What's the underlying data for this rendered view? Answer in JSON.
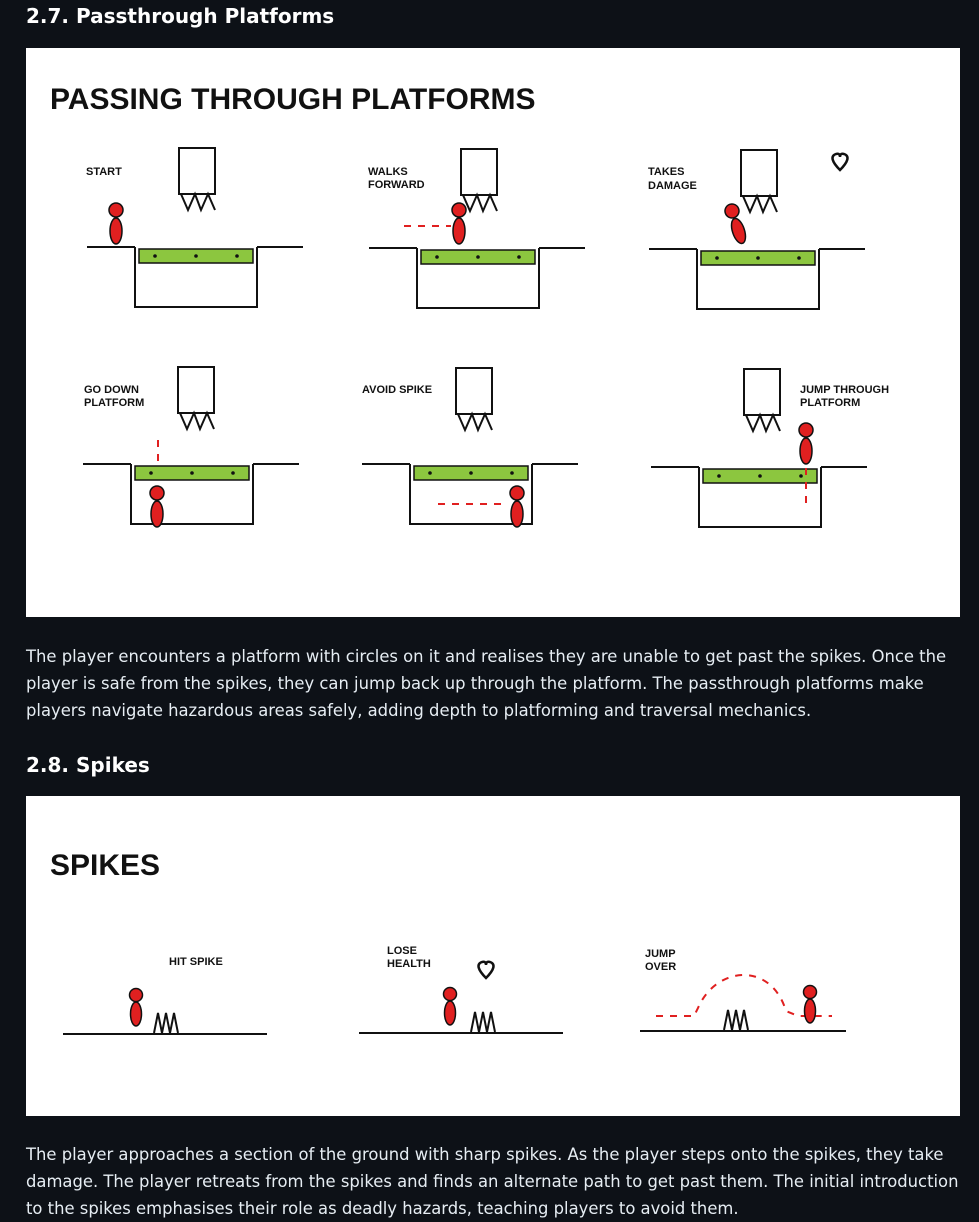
{
  "section_platforms": {
    "heading": "2.7. Passthrough Platforms",
    "diagram": {
      "title": "PASSING THROUGH PLATFORMS",
      "labels": {
        "start": "START",
        "walks_1": "WALKS",
        "walks_2": "FORWARD",
        "takes_1": "TAKES",
        "takes_2": "DAMAGE",
        "go_down_1": "GO DOWN",
        "go_down_2": "PLATFORM",
        "avoid_spike": "AVOID SPIKE",
        "jump_through_1": "JUMP THROUGH",
        "jump_through_2": "PLATFORM"
      }
    },
    "paragraph": "The player encounters a platform with circles on it and realises they are unable to get past the spikes. Once the player is safe from the spikes, they can jump back up through the platform. The passthrough platforms make players navigate hazardous areas safely, adding depth to platforming and traversal mechanics."
  },
  "section_spikes": {
    "heading": "2.8. Spikes",
    "diagram": {
      "title": "SPIKES",
      "labels": {
        "hit_spike": "HIT SPIKE",
        "lose_1": "LOSE",
        "lose_2": "HEALTH",
        "jump_1": "JUMP",
        "jump_2": "OVER"
      }
    },
    "paragraph": "The player approaches a section of the ground with sharp spikes. As the player steps onto the spikes, they take damage. The player retreats from the spikes and finds an alternate path to get past them. The initial introduction to the spikes emphasises their role as deadly hazards, teaching players to avoid them."
  },
  "colors": {
    "page_bg": "#0d1117",
    "text": "#e6edf3",
    "platform_green": "#8cc63f",
    "player_red": "#e02020"
  }
}
